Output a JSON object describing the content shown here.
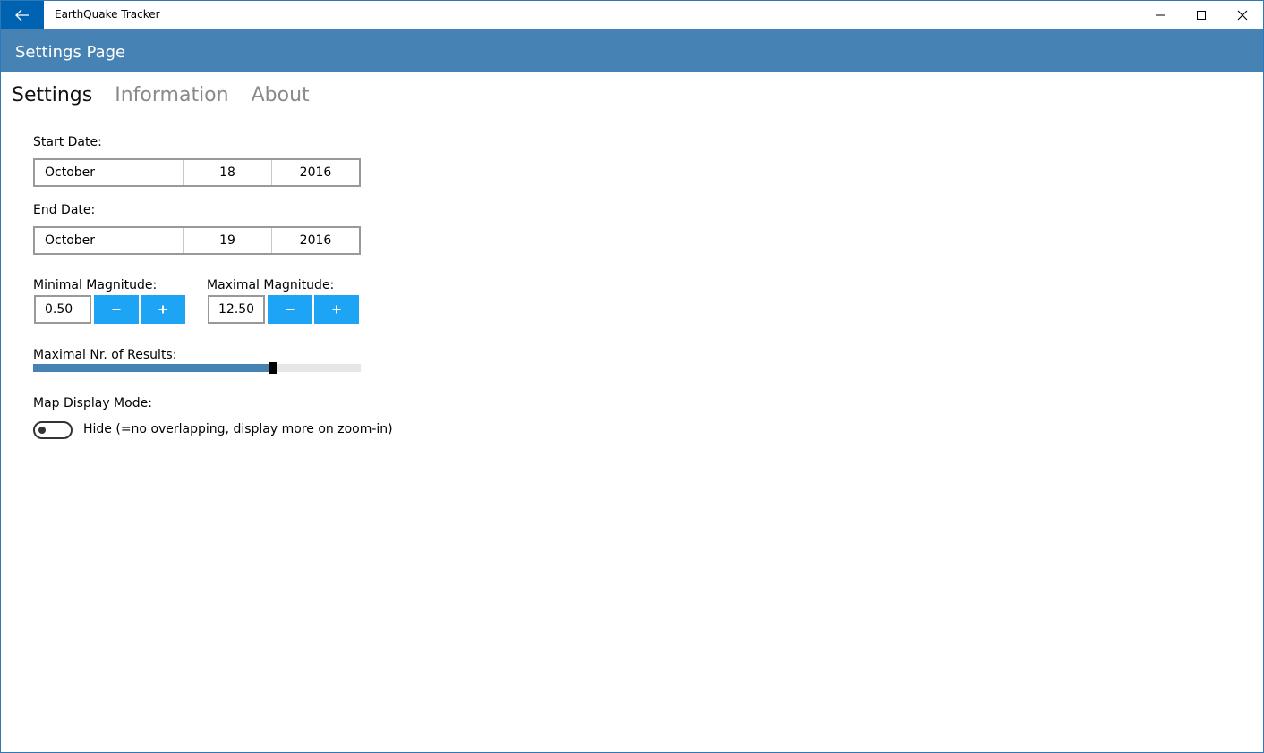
{
  "window": {
    "title": "EarthQuake Tracker"
  },
  "header": {
    "title": "Settings Page"
  },
  "tabs": [
    {
      "label": "Settings",
      "active": true
    },
    {
      "label": "Information",
      "active": false
    },
    {
      "label": "About",
      "active": false
    }
  ],
  "start_date": {
    "label": "Start Date:",
    "month": "October",
    "day": "18",
    "year": "2016"
  },
  "end_date": {
    "label": "End Date:",
    "month": "October",
    "day": "19",
    "year": "2016"
  },
  "min_magnitude": {
    "label": "Minimal Magnitude:",
    "value": "0.50",
    "minus": "−",
    "plus": "+"
  },
  "max_magnitude": {
    "label": "Maximal Magnitude:",
    "value": "12.50",
    "minus": "−",
    "plus": "+"
  },
  "max_results": {
    "label": "Maximal Nr. of Results:",
    "fraction": 0.73
  },
  "map_mode": {
    "label": "Map Display Mode:",
    "toggle_on": false,
    "toggle_text": "Hide (=no overlapping, display more on zoom-in)"
  },
  "colors": {
    "accent": "#4682b4",
    "button": "#1ea4f5",
    "back": "#0063b1"
  },
  "icons": {
    "back": "arrow-left-icon",
    "minimize": "minimize-icon",
    "maximize": "maximize-icon",
    "close": "close-icon"
  }
}
